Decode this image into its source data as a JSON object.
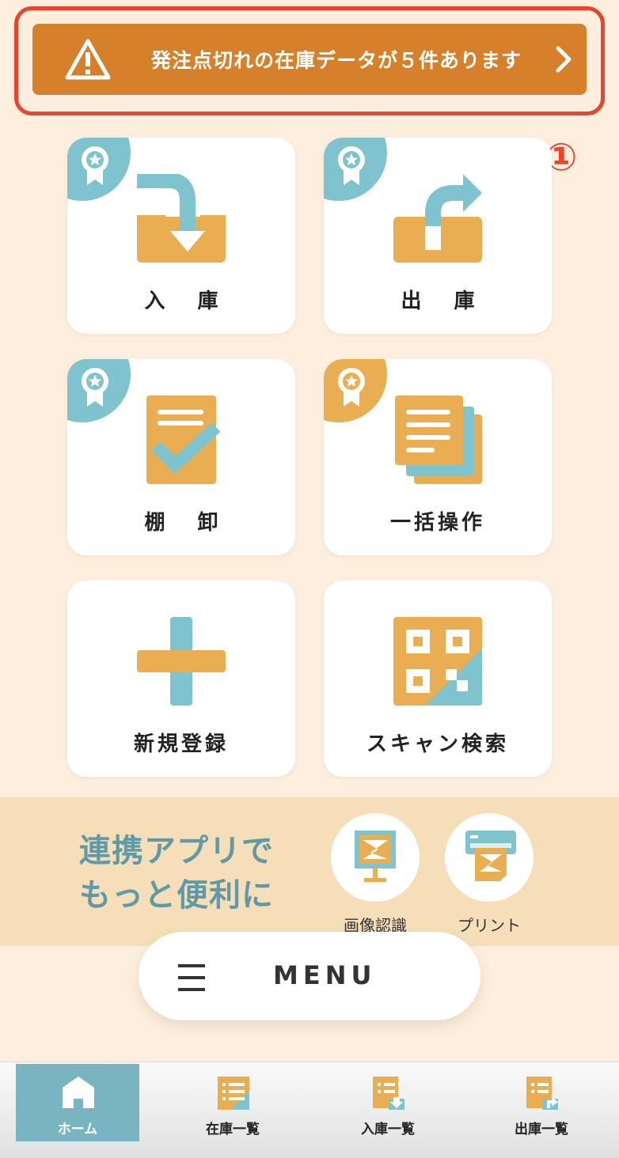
{
  "alert": {
    "message": "発注点切れの在庫データが５件あります",
    "step_marker": "①"
  },
  "tiles": [
    {
      "label": "入 庫",
      "badge": true
    },
    {
      "label": "出 庫",
      "badge": true
    },
    {
      "label": "棚 卸",
      "badge": true
    },
    {
      "label": "一括操作",
      "badge": true
    },
    {
      "label": "新規登録",
      "badge": false
    },
    {
      "label": "スキャン検索",
      "badge": false
    }
  ],
  "partner": {
    "title_line1": "連携アプリで",
    "title_line2": "もっと便利に",
    "apps": [
      {
        "label": "画像認識",
        "icon": "image-recognition-icon"
      },
      {
        "label": "プリント",
        "icon": "printer-icon"
      }
    ]
  },
  "menu": {
    "label": "MENU"
  },
  "bottom_nav": [
    {
      "label": "ホーム",
      "icon": "home-icon",
      "active": true
    },
    {
      "label": "在庫一覧",
      "icon": "inventory-list-icon",
      "active": false
    },
    {
      "label": "入庫一覧",
      "icon": "inbound-list-icon",
      "active": false
    },
    {
      "label": "出庫一覧",
      "icon": "outbound-list-icon",
      "active": false
    }
  ],
  "colors": {
    "orange": "#e9ae52",
    "teal": "#7fc3cf",
    "alert": "#d6802c",
    "highlight": "#e8452c"
  }
}
